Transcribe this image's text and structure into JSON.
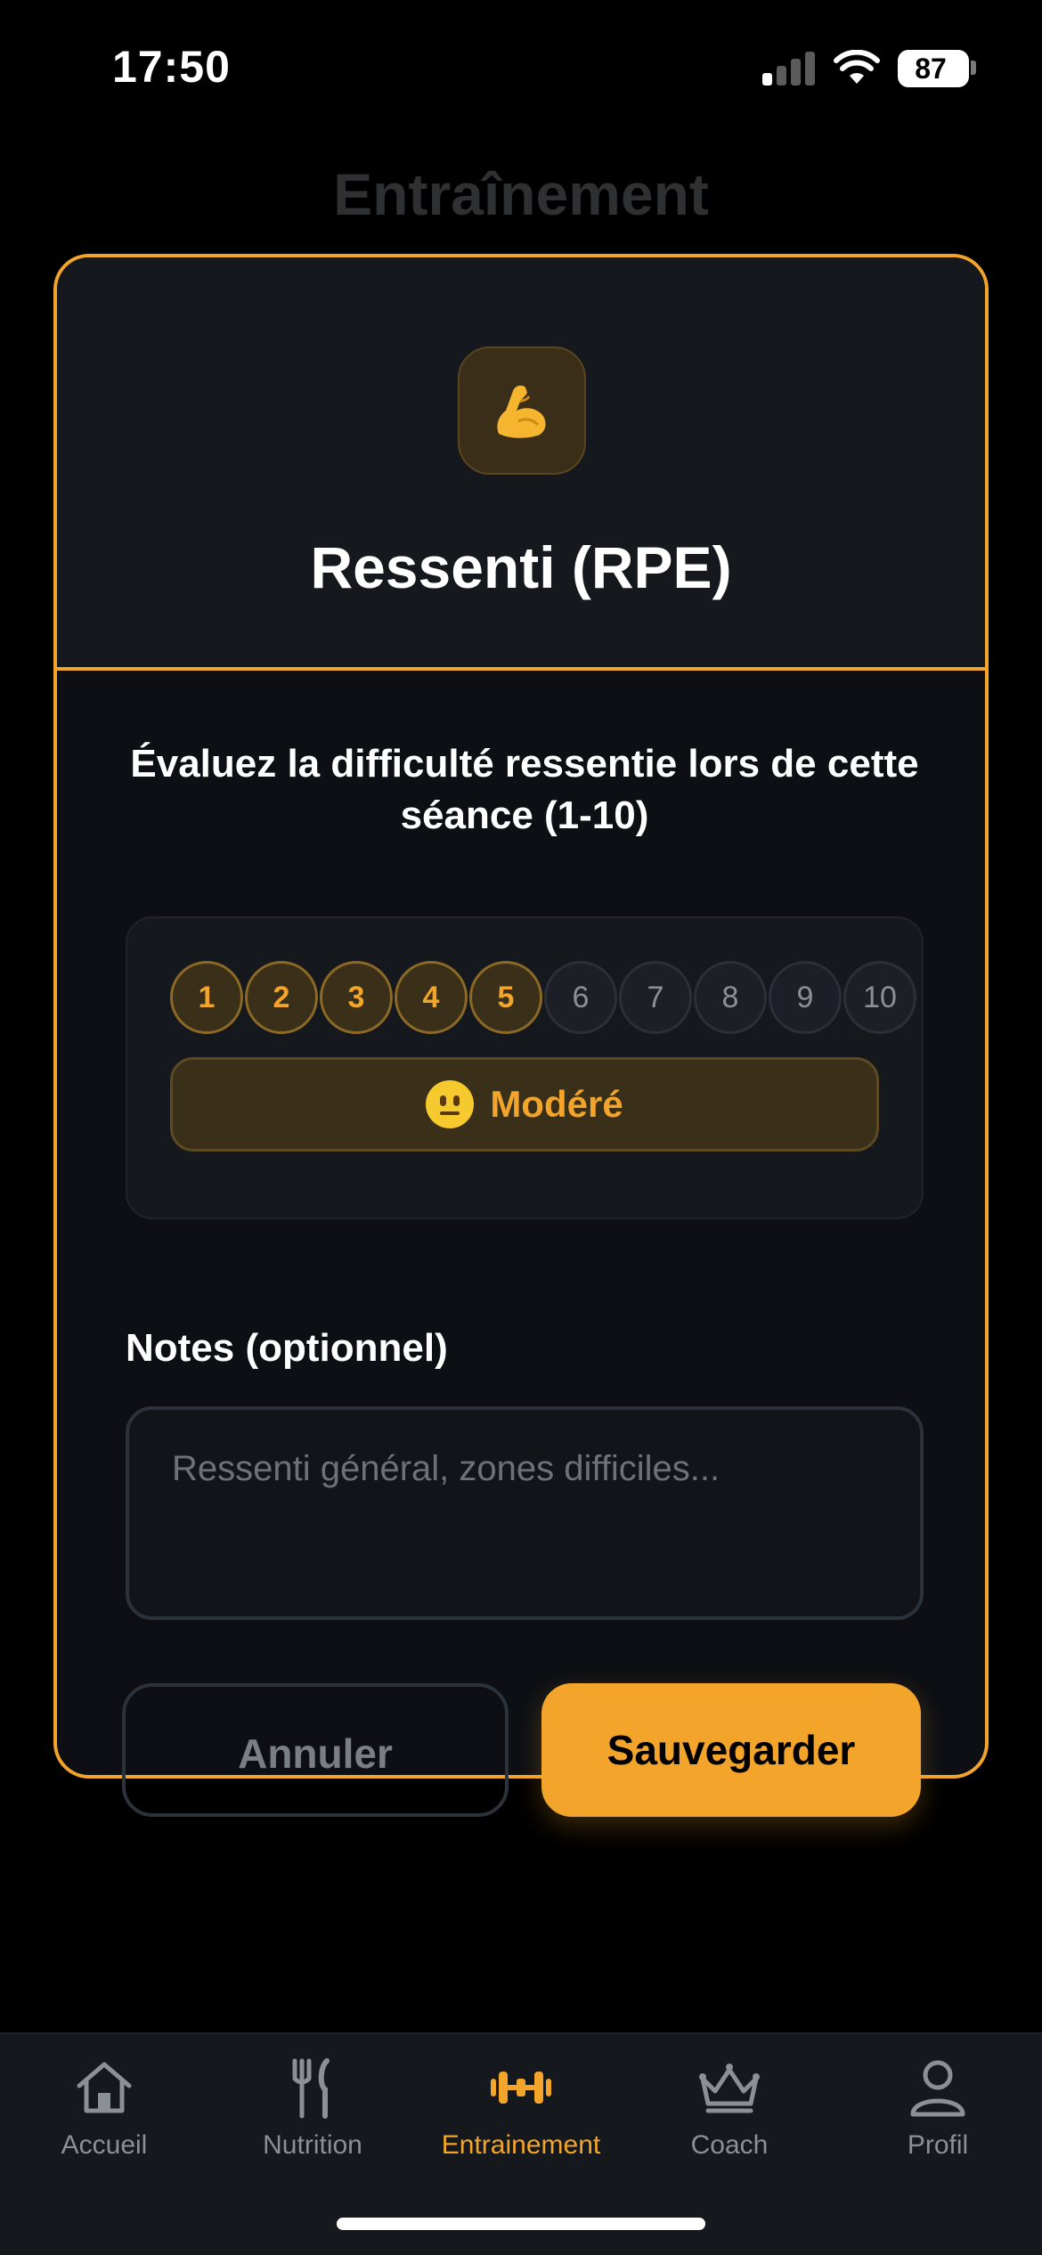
{
  "status_bar": {
    "time": "17:50",
    "battery_level": "87",
    "signal_icon": "cellular-signal-icon",
    "wifi_icon": "wifi-icon"
  },
  "page": {
    "title": "Entraînement"
  },
  "modal": {
    "icon": "flexed-biceps-icon",
    "title": "Ressenti (RPE)",
    "prompt": "Évaluez la difficulté ressentie lors de cette séance (1-10)",
    "rpe": {
      "values": [
        "1",
        "2",
        "3",
        "4",
        "5",
        "6",
        "7",
        "8",
        "9",
        "10"
      ],
      "selected": 5,
      "level_label": "Modéré",
      "level_icon": "neutral-face-emoji"
    },
    "notes": {
      "label": "Notes (optionnel)",
      "placeholder": "Ressenti général, zones difficiles...",
      "value": ""
    },
    "buttons": {
      "cancel": "Annuler",
      "save": "Sauvegarder"
    }
  },
  "tab_bar": {
    "items": [
      {
        "label": "Accueil",
        "icon": "home-icon",
        "active": false
      },
      {
        "label": "Nutrition",
        "icon": "fork-knife-icon",
        "active": false
      },
      {
        "label": "Entrainement",
        "icon": "dumbbell-icon",
        "active": true
      },
      {
        "label": "Coach",
        "icon": "crown-icon",
        "active": false
      },
      {
        "label": "Profil",
        "icon": "user-icon",
        "active": false
      }
    ]
  },
  "colors": {
    "accent": "#f2a52a",
    "background": "#000000",
    "surface": "#15181d",
    "muted_text": "#8b8f96"
  }
}
